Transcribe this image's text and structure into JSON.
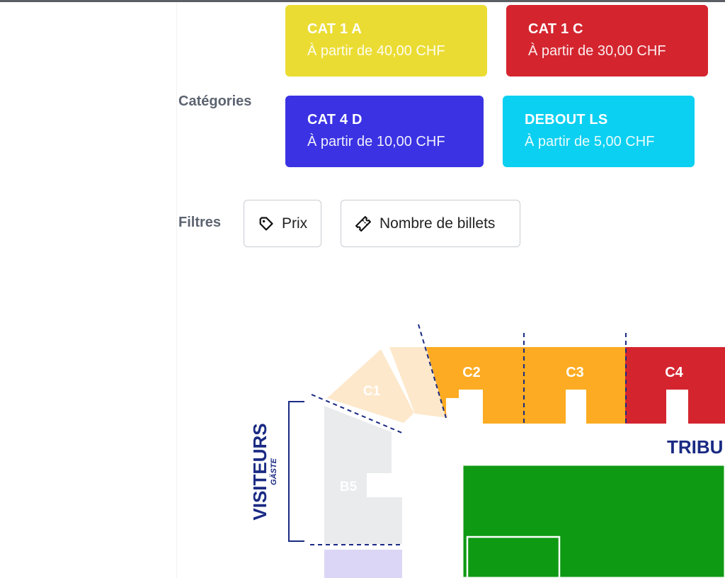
{
  "categories_label": "Catégories",
  "filters_label": "Filtres",
  "categories": [
    {
      "name": "CAT 1 A",
      "price": "À partir de 40,00 CHF",
      "color": "#ebdc33"
    },
    {
      "name": "CAT 1 C",
      "price": "À partir de 30,00 CHF",
      "color": "#d4252f"
    },
    {
      "name": "CAT 4 D",
      "price": "À partir de 10,00 CHF",
      "color": "#3a32e3"
    },
    {
      "name": "DEBOUT LS",
      "price": "À partir de 5,00 CHF",
      "color": "#0bd0f1"
    }
  ],
  "filters": [
    {
      "label": "Prix",
      "icon": "price-tag-icon"
    },
    {
      "label": "Nombre de billets",
      "icon": "ticket-icon"
    }
  ],
  "map": {
    "sections": {
      "c1": "C1",
      "c2": "C2",
      "c3": "C3",
      "c4": "C4",
      "b5": "B5"
    },
    "visitors_label": "VISITEURS",
    "visitors_sub": "GÄSTE",
    "tribune_label": "TRIBU",
    "colors": {
      "c_light": "#fde8cb",
      "c_orange": "#fcab22",
      "c_red": "#d4252f",
      "b5": "#e9ebec",
      "pitch": "#0f9a13",
      "navy": "#1a2a83"
    }
  }
}
